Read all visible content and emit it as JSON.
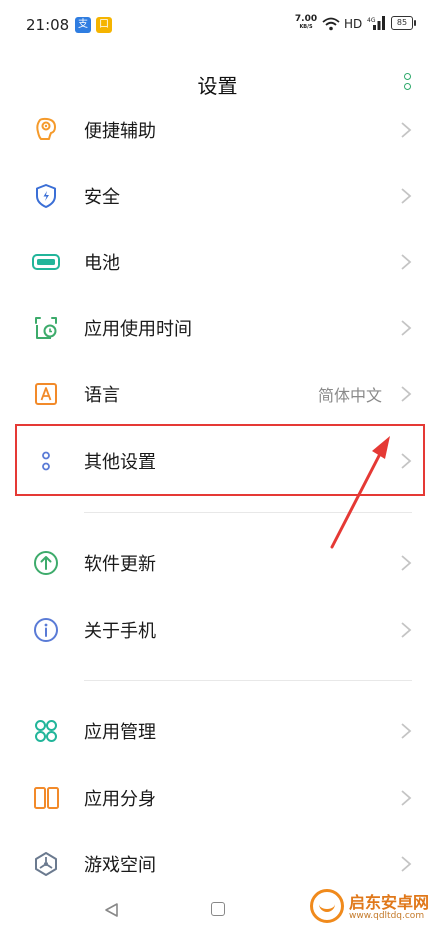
{
  "status_bar": {
    "time": "21:08",
    "app_badge_1": "支",
    "app_badge_2": "口",
    "net_speed": "7.00",
    "net_speed_unit": "KB/S",
    "hd": "HD",
    "battery": "85"
  },
  "header": {
    "title": "设置",
    "more_icon": "more-vertical-icon"
  },
  "settings": [
    {
      "label": "便捷辅助",
      "icon": "accessibility-icon",
      "icon_color": "#f59a2b"
    },
    {
      "label": "安全",
      "icon": "shield-icon",
      "icon_color": "#3b6fd6"
    },
    {
      "label": "电池",
      "icon": "battery-icon",
      "icon_color": "#22b59a"
    },
    {
      "label": "应用使用时间",
      "icon": "alarm-clock-icon",
      "icon_color": "#3dab6b"
    },
    {
      "label": "语言",
      "value": "简体中文",
      "icon": "language-icon",
      "icon_color": "#f28a2a"
    },
    {
      "label": "其他设置",
      "icon": "more-settings-icon",
      "icon_color": "#5a7bd6"
    },
    {
      "label": "软件更新",
      "icon": "update-icon",
      "icon_color": "#3dab6b"
    },
    {
      "label": "关于手机",
      "icon": "info-icon",
      "icon_color": "#5a7bd6"
    },
    {
      "label": "应用管理",
      "icon": "apps-icon",
      "icon_color": "#22b59a"
    },
    {
      "label": "应用分身",
      "icon": "app-clone-icon",
      "icon_color": "#f28a2a"
    },
    {
      "label": "游戏空间",
      "icon": "game-space-icon",
      "icon_color": "#6b7a8f"
    }
  ],
  "watermark": {
    "text": "启东安卓网",
    "url": "www.qdltdq.com"
  },
  "colors": {
    "accent": "#2ea96b",
    "highlight": "#e53935"
  }
}
